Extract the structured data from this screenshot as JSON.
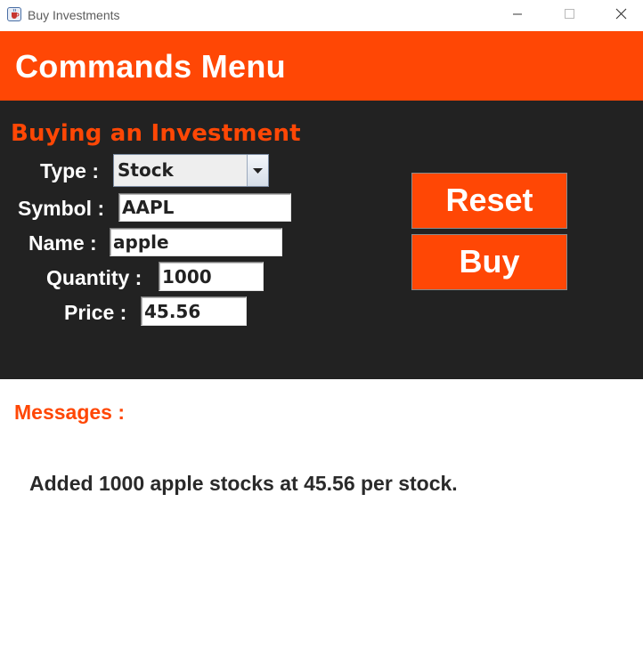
{
  "window": {
    "title": "Buy Investments",
    "icon": "java-cup-icon"
  },
  "header": {
    "title": "Commands Menu"
  },
  "form": {
    "section_title": "Buying an Investment",
    "type": {
      "label": "Type :",
      "selected": "Stock"
    },
    "symbol": {
      "label": "Symbol :",
      "value": "AAPL"
    },
    "name": {
      "label": "Name :",
      "value": "apple"
    },
    "quantity": {
      "label": "Quantity :",
      "value": "1000"
    },
    "price": {
      "label": "Price :",
      "value": "45.56"
    }
  },
  "buttons": {
    "reset_label": "Reset",
    "buy_label": "Buy"
  },
  "messages": {
    "label": "Messages :",
    "text": "Added 1000 apple stocks at 45.56 per stock."
  },
  "colors": {
    "accent": "#ff4705",
    "panel_background": "#222222",
    "window_background": "#ffffff"
  }
}
